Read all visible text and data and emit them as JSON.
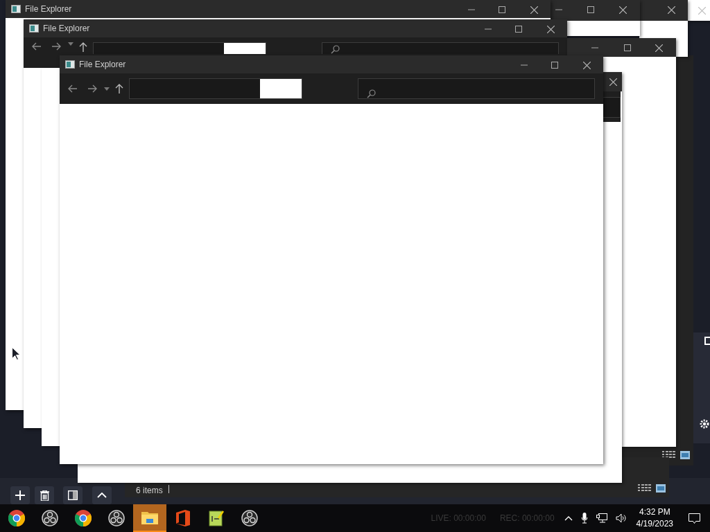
{
  "windows": [
    {
      "title": "File Explorer"
    },
    {
      "title": "File Explorer"
    },
    {
      "title": "File Explorer"
    }
  ],
  "back_window": {
    "status": "6 items"
  },
  "taskbar": {
    "apps": [
      {
        "kind": "chrome",
        "active": false
      },
      {
        "kind": "obs",
        "active": false
      },
      {
        "kind": "chrome",
        "active": false
      },
      {
        "kind": "obs",
        "active": false
      },
      {
        "kind": "explorer",
        "active": true
      },
      {
        "kind": "office",
        "active": false
      },
      {
        "kind": "notepad",
        "active": false
      },
      {
        "kind": "obs",
        "active": false
      }
    ],
    "live": "LIVE: 00:00:00",
    "rec": "REC: 00:00:00",
    "time": "4:32 PM",
    "date": "4/19/2023"
  }
}
